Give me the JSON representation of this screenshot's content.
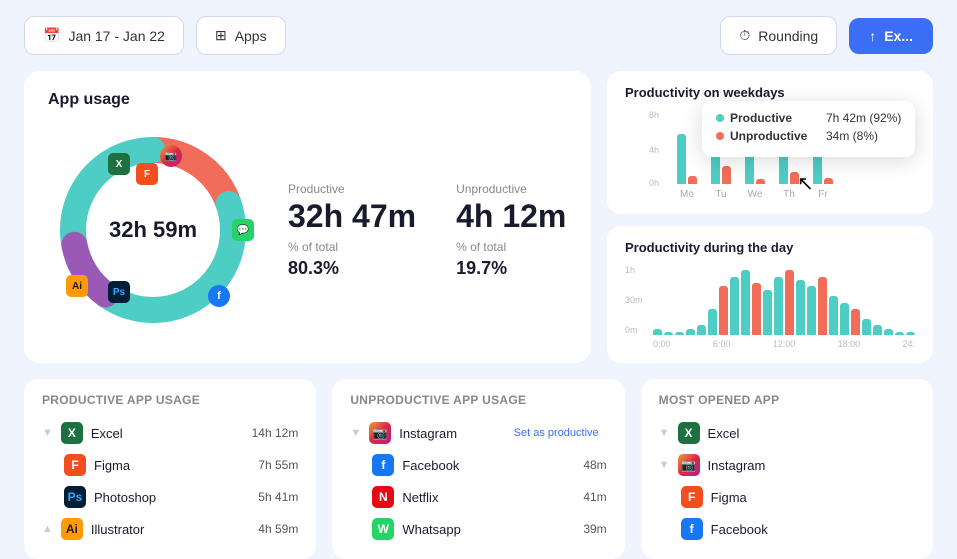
{
  "topbar": {
    "date_label": "Jan 17 - Jan 22",
    "apps_label": "Apps",
    "rounding_label": "Rounding",
    "export_label": "Ex..."
  },
  "app_usage": {
    "title": "App usage",
    "total_time": "32h 59m",
    "productive_label": "Productive",
    "productive_value": "32h 47m",
    "productive_pct_label": "% of total",
    "productive_pct": "80.3%",
    "unproductive_label": "Unproductive",
    "unproductive_value": "4h 12m",
    "unproductive_pct_label": "% of total",
    "unproductive_pct": "19.7%"
  },
  "tooltip": {
    "prod_label": "Productive",
    "prod_value": "7h 42m (92%)",
    "unprod_label": "Unproductive",
    "unprod_value": "34m (8%)"
  },
  "weekday_chart": {
    "title": "Productivity on weekdays",
    "y_labels": [
      "8h",
      "4h",
      "0h"
    ],
    "days": [
      {
        "label": "Mo",
        "prod": 50,
        "unprod": 8
      },
      {
        "label": "Tu",
        "prod": 65,
        "unprod": 18
      },
      {
        "label": "We",
        "prod": 55,
        "unprod": 5
      },
      {
        "label": "Th",
        "prod": 60,
        "unprod": 12
      },
      {
        "label": "Fr",
        "prod": 58,
        "unprod": 6
      }
    ]
  },
  "day_chart": {
    "title": "Productivity during the day",
    "y_labels": [
      "1h",
      "30m",
      "0m"
    ],
    "x_labels": [
      "0:00",
      "6:00",
      "12:00",
      "18:00",
      "24:"
    ],
    "bars": [
      2,
      1,
      1,
      2,
      3,
      8,
      15,
      18,
      20,
      16,
      14,
      18,
      20,
      17,
      15,
      18,
      12,
      10,
      8,
      5,
      3,
      2,
      1,
      1
    ]
  },
  "productive_apps": {
    "title": "Productive app usage",
    "items": [
      {
        "name": "Excel",
        "time": "14h 12m",
        "icon": "excel",
        "expanded": true
      },
      {
        "name": "Figma",
        "time": "7h 55m",
        "icon": "figma",
        "expanded": false
      },
      {
        "name": "Photoshop",
        "time": "5h 41m",
        "icon": "ps",
        "expanded": false
      },
      {
        "name": "Illustrator",
        "time": "4h 59m",
        "icon": "ai",
        "expanded": true
      }
    ]
  },
  "unproductive_apps": {
    "title": "Unproductive app usage",
    "items": [
      {
        "name": "Instagram",
        "time": "",
        "icon": "ig",
        "set_prod": "Set as productive",
        "expanded": true
      },
      {
        "name": "Facebook",
        "time": "48m",
        "icon": "fb",
        "expanded": false
      },
      {
        "name": "Netflix",
        "time": "41m",
        "icon": "netflix",
        "expanded": false
      },
      {
        "name": "Whatsapp",
        "time": "39m",
        "icon": "wa",
        "expanded": false
      }
    ]
  },
  "most_opened": {
    "title": "Most opened app",
    "items": [
      {
        "name": "Excel",
        "icon": "excel"
      },
      {
        "name": "Instagram",
        "icon": "ig"
      },
      {
        "name": "Figma",
        "icon": "figma"
      },
      {
        "name": "Facebook",
        "icon": "fb"
      }
    ]
  },
  "colors": {
    "productive": "#4ecdc4",
    "unproductive": "#f26c5a",
    "accent": "#3b6ef5"
  }
}
